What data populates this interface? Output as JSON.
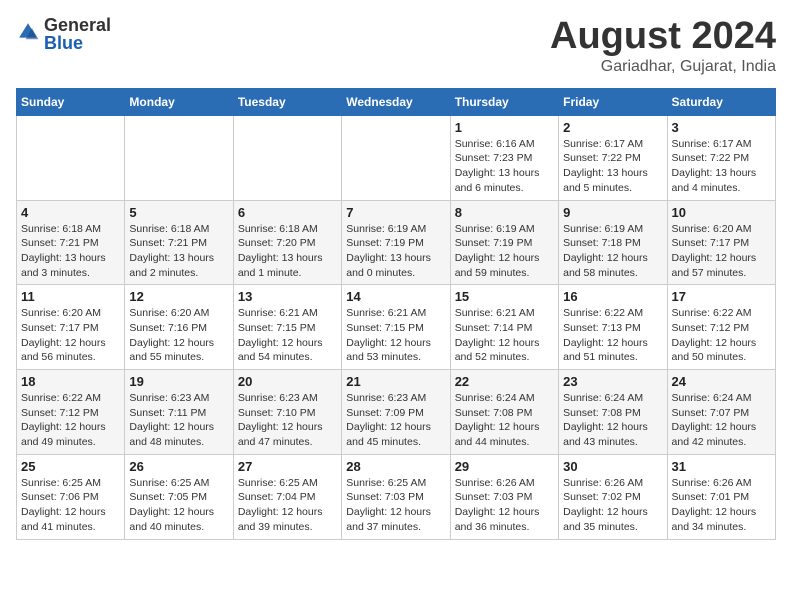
{
  "logo": {
    "general": "General",
    "blue": "Blue"
  },
  "title": "August 2024",
  "subtitle": "Gariadhar, Gujarat, India",
  "days_of_week": [
    "Sunday",
    "Monday",
    "Tuesday",
    "Wednesday",
    "Thursday",
    "Friday",
    "Saturday"
  ],
  "weeks": [
    [
      {
        "day": "",
        "info": ""
      },
      {
        "day": "",
        "info": ""
      },
      {
        "day": "",
        "info": ""
      },
      {
        "day": "",
        "info": ""
      },
      {
        "day": "1",
        "info": "Sunrise: 6:16 AM\nSunset: 7:23 PM\nDaylight: 13 hours\nand 6 minutes."
      },
      {
        "day": "2",
        "info": "Sunrise: 6:17 AM\nSunset: 7:22 PM\nDaylight: 13 hours\nand 5 minutes."
      },
      {
        "day": "3",
        "info": "Sunrise: 6:17 AM\nSunset: 7:22 PM\nDaylight: 13 hours\nand 4 minutes."
      }
    ],
    [
      {
        "day": "4",
        "info": "Sunrise: 6:18 AM\nSunset: 7:21 PM\nDaylight: 13 hours\nand 3 minutes."
      },
      {
        "day": "5",
        "info": "Sunrise: 6:18 AM\nSunset: 7:21 PM\nDaylight: 13 hours\nand 2 minutes."
      },
      {
        "day": "6",
        "info": "Sunrise: 6:18 AM\nSunset: 7:20 PM\nDaylight: 13 hours\nand 1 minute."
      },
      {
        "day": "7",
        "info": "Sunrise: 6:19 AM\nSunset: 7:19 PM\nDaylight: 13 hours\nand 0 minutes."
      },
      {
        "day": "8",
        "info": "Sunrise: 6:19 AM\nSunset: 7:19 PM\nDaylight: 12 hours\nand 59 minutes."
      },
      {
        "day": "9",
        "info": "Sunrise: 6:19 AM\nSunset: 7:18 PM\nDaylight: 12 hours\nand 58 minutes."
      },
      {
        "day": "10",
        "info": "Sunrise: 6:20 AM\nSunset: 7:17 PM\nDaylight: 12 hours\nand 57 minutes."
      }
    ],
    [
      {
        "day": "11",
        "info": "Sunrise: 6:20 AM\nSunset: 7:17 PM\nDaylight: 12 hours\nand 56 minutes."
      },
      {
        "day": "12",
        "info": "Sunrise: 6:20 AM\nSunset: 7:16 PM\nDaylight: 12 hours\nand 55 minutes."
      },
      {
        "day": "13",
        "info": "Sunrise: 6:21 AM\nSunset: 7:15 PM\nDaylight: 12 hours\nand 54 minutes."
      },
      {
        "day": "14",
        "info": "Sunrise: 6:21 AM\nSunset: 7:15 PM\nDaylight: 12 hours\nand 53 minutes."
      },
      {
        "day": "15",
        "info": "Sunrise: 6:21 AM\nSunset: 7:14 PM\nDaylight: 12 hours\nand 52 minutes."
      },
      {
        "day": "16",
        "info": "Sunrise: 6:22 AM\nSunset: 7:13 PM\nDaylight: 12 hours\nand 51 minutes."
      },
      {
        "day": "17",
        "info": "Sunrise: 6:22 AM\nSunset: 7:12 PM\nDaylight: 12 hours\nand 50 minutes."
      }
    ],
    [
      {
        "day": "18",
        "info": "Sunrise: 6:22 AM\nSunset: 7:12 PM\nDaylight: 12 hours\nand 49 minutes."
      },
      {
        "day": "19",
        "info": "Sunrise: 6:23 AM\nSunset: 7:11 PM\nDaylight: 12 hours\nand 48 minutes."
      },
      {
        "day": "20",
        "info": "Sunrise: 6:23 AM\nSunset: 7:10 PM\nDaylight: 12 hours\nand 47 minutes."
      },
      {
        "day": "21",
        "info": "Sunrise: 6:23 AM\nSunset: 7:09 PM\nDaylight: 12 hours\nand 45 minutes."
      },
      {
        "day": "22",
        "info": "Sunrise: 6:24 AM\nSunset: 7:08 PM\nDaylight: 12 hours\nand 44 minutes."
      },
      {
        "day": "23",
        "info": "Sunrise: 6:24 AM\nSunset: 7:08 PM\nDaylight: 12 hours\nand 43 minutes."
      },
      {
        "day": "24",
        "info": "Sunrise: 6:24 AM\nSunset: 7:07 PM\nDaylight: 12 hours\nand 42 minutes."
      }
    ],
    [
      {
        "day": "25",
        "info": "Sunrise: 6:25 AM\nSunset: 7:06 PM\nDaylight: 12 hours\nand 41 minutes."
      },
      {
        "day": "26",
        "info": "Sunrise: 6:25 AM\nSunset: 7:05 PM\nDaylight: 12 hours\nand 40 minutes."
      },
      {
        "day": "27",
        "info": "Sunrise: 6:25 AM\nSunset: 7:04 PM\nDaylight: 12 hours\nand 39 minutes."
      },
      {
        "day": "28",
        "info": "Sunrise: 6:25 AM\nSunset: 7:03 PM\nDaylight: 12 hours\nand 37 minutes."
      },
      {
        "day": "29",
        "info": "Sunrise: 6:26 AM\nSunset: 7:03 PM\nDaylight: 12 hours\nand 36 minutes."
      },
      {
        "day": "30",
        "info": "Sunrise: 6:26 AM\nSunset: 7:02 PM\nDaylight: 12 hours\nand 35 minutes."
      },
      {
        "day": "31",
        "info": "Sunrise: 6:26 AM\nSunset: 7:01 PM\nDaylight: 12 hours\nand 34 minutes."
      }
    ]
  ]
}
